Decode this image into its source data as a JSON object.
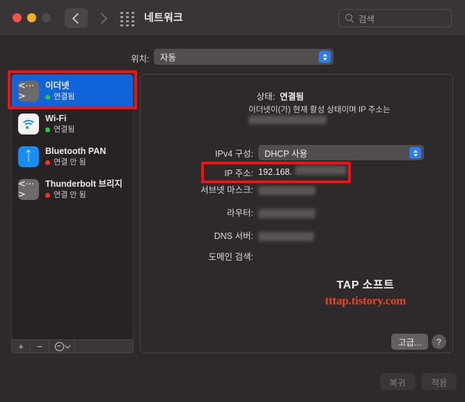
{
  "window": {
    "title": "네트워크",
    "traffic_lights": [
      "close",
      "minimize",
      "zoom"
    ]
  },
  "titlebar": {
    "back_icon": "chevron-left-icon",
    "forward_icon": "chevron-right-icon",
    "grid_icon": "show-all-grid-icon",
    "search": {
      "placeholder": "검색",
      "value": "",
      "icon": "search-icon"
    }
  },
  "location": {
    "label": "위치:",
    "selected": "자동"
  },
  "sidebar": {
    "services": [
      {
        "name": "이더넷",
        "status": "연결됨",
        "status_color": "#2fc73f",
        "icon": "ethernet-icon",
        "selected": true
      },
      {
        "name": "Wi-Fi",
        "status": "연결됨",
        "status_color": "#2fc73f",
        "icon": "wifi-icon",
        "selected": false
      },
      {
        "name": "Bluetooth PAN",
        "status": "연결 안 됨",
        "status_color": "#f0342a",
        "icon": "bluetooth-icon",
        "selected": false
      },
      {
        "name": "Thunderbolt 브리지",
        "status": "연결 안 됨",
        "status_color": "#f0342a",
        "icon": "ethernet-icon",
        "selected": false
      }
    ],
    "toolbar": {
      "add_label": "+",
      "remove_label": "−",
      "action_icon": "action-gear-icon",
      "action_chevron_icon": "chevron-down-icon"
    }
  },
  "detail": {
    "status_label": "상태:",
    "status_value": "연결됨",
    "status_description": "이더넷이(가) 현재 활성 상태이며 IP 주소는",
    "status_description_redacted": true,
    "ipv4_label": "IPv4 구성:",
    "ipv4_value": "DHCP 사용",
    "ip_label": "IP 주소:",
    "ip_value": "192.168.",
    "ip_value_redacted": true,
    "subnet_label": "서브넷 마스크:",
    "subnet_value_redacted": true,
    "router_label": "라우터:",
    "router_value_redacted": true,
    "dns_label": "DNS 서버:",
    "dns_value_redacted": true,
    "domain_label": "도메인 검색:",
    "advanced_label": "고급...",
    "help_label": "?"
  },
  "footer": {
    "revert_label": "복귀",
    "apply_label": "적용"
  },
  "watermark": {
    "line1": "TAP 소프트",
    "line2": "tttap.tistory.com",
    "line2_color": "#e8442a"
  },
  "annotations": {
    "highlight_color": "#f41111",
    "boxes": [
      "ethernet-service-row",
      "ip-address-row"
    ]
  }
}
